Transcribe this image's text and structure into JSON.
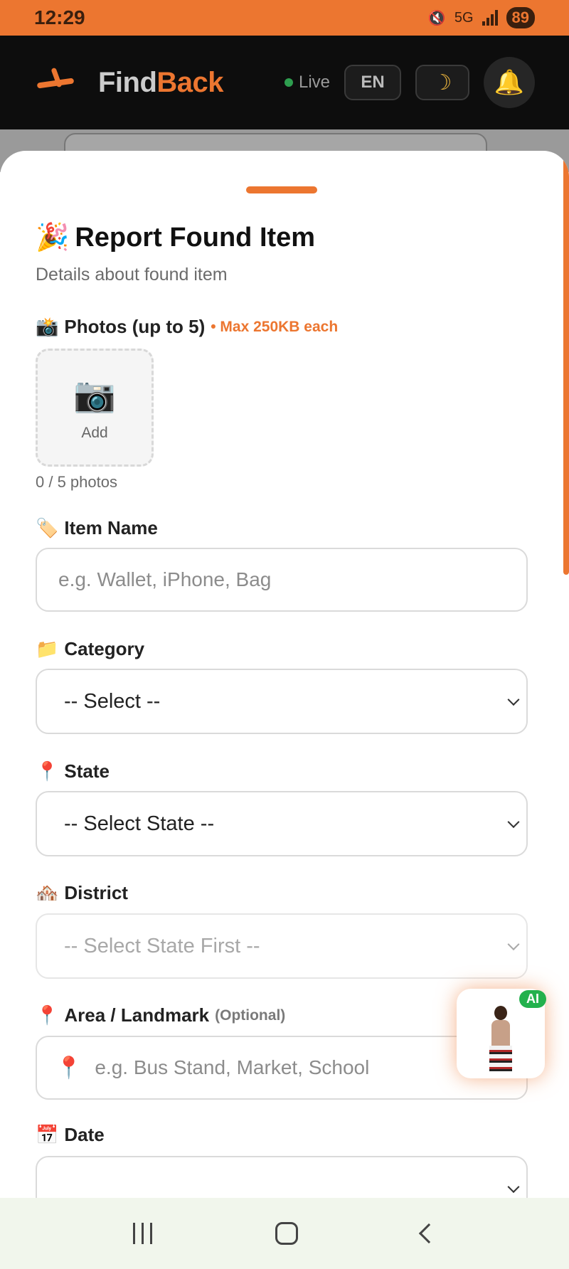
{
  "status_bar": {
    "time": "12:29",
    "battery": "89",
    "network": "5G"
  },
  "header": {
    "brand_part1": "Find",
    "brand_part2": "Back",
    "live_label": "Live",
    "language": "EN",
    "theme_icon": "☽",
    "bell_icon": "🔔"
  },
  "sheet": {
    "title_emoji": "🎉",
    "title": "Report Found Item",
    "subtitle": "Details about found item"
  },
  "photos": {
    "emoji": "📸",
    "label": "Photos (up to 5)",
    "max_note": "• Max 250KB each",
    "add_icon": "📷",
    "add_label": "Add",
    "count_text": "0 / 5 photos"
  },
  "item_name": {
    "emoji": "🏷️",
    "label": "Item Name",
    "placeholder": "e.g. Wallet, iPhone, Bag"
  },
  "category": {
    "emoji": "📁",
    "label": "Category",
    "selected": "-- Select --"
  },
  "state": {
    "emoji": "📍",
    "label": "State",
    "selected": "-- Select State --"
  },
  "district": {
    "emoji": "🏘️",
    "label": "District",
    "selected": "-- Select State First --"
  },
  "area": {
    "emoji": "📍",
    "label": "Area / Landmark",
    "optional": "(Optional)",
    "pin": "📍",
    "placeholder": "e.g. Bus Stand, Market, School"
  },
  "date": {
    "emoji": "📅",
    "label": "Date"
  },
  "ai_assistant": {
    "badge": "AI"
  },
  "colors": {
    "accent": "#EC7630",
    "header_bg": "#0d0d0d",
    "live_dot": "#2e9e4f",
    "ai_badge": "#23b14d"
  }
}
